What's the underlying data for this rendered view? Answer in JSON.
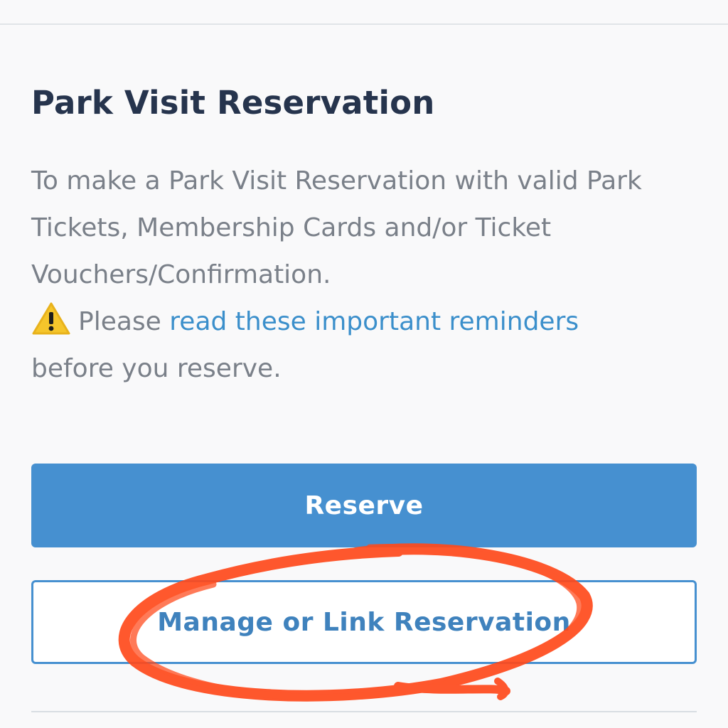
{
  "page": {
    "title": "Park Visit Reservation",
    "description": "To make a Park Visit Reservation with valid Park Tickets, Membership Cards and/or Ticket Vouchers/Confirmation.",
    "reminder": {
      "icon": "warning-icon",
      "prefix": "Please ",
      "link_text": "read these important reminders",
      "suffix": "before you reserve."
    }
  },
  "actions": {
    "reserve_label": "Reserve",
    "manage_label": "Manage or Link Reservation"
  },
  "colors": {
    "primary": "#4690d0",
    "title": "#26344d",
    "body_text": "#7a8089",
    "link": "#3b8fcb",
    "annotation": "#ff4a1c"
  }
}
